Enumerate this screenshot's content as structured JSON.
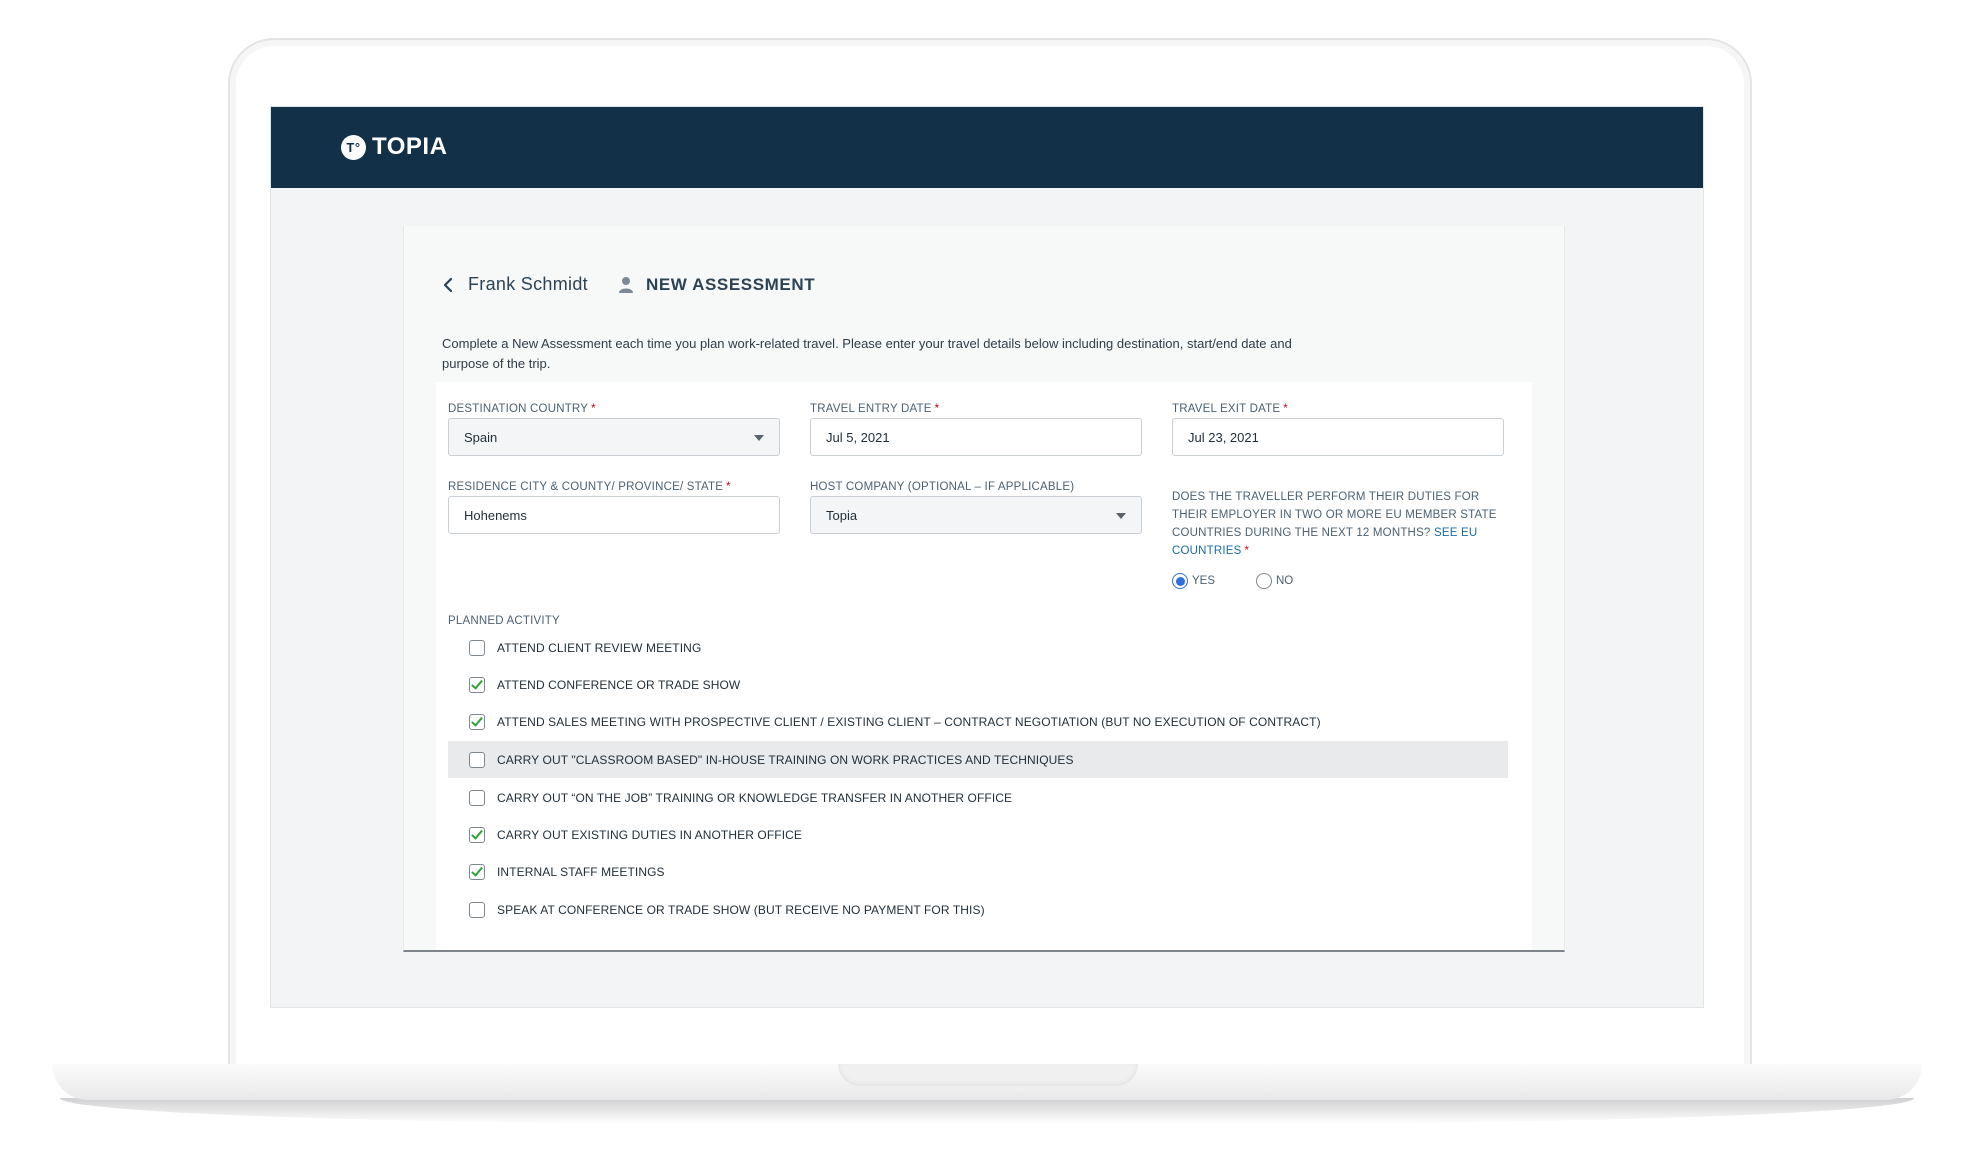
{
  "brand": {
    "name": "TOPIA",
    "mark": "T°"
  },
  "header": {
    "back_label": "Frank Schmidt",
    "title": "NEW ASSESSMENT"
  },
  "intro": "Complete a New Assessment each time you plan work-related travel. Please enter your travel details below including destination, start/end date and purpose of the trip.",
  "fields": {
    "destination_country": {
      "label": "DESTINATION COUNTRY",
      "value": "Spain"
    },
    "travel_entry_date": {
      "label": "TRAVEL ENTRY DATE",
      "value": "Jul 5, 2021"
    },
    "travel_exit_date": {
      "label": "TRAVEL EXIT DATE",
      "value": "Jul 23, 2021"
    },
    "residence": {
      "label": "RESIDENCE CITY & COUNTY/ PROVINCE/ STATE",
      "value": "Hohenems"
    },
    "host_company": {
      "label": "HOST COMPANY (OPTIONAL – IF APPLICABLE)",
      "value": "Topia"
    }
  },
  "eu_question": {
    "text": "DOES THE TRAVELLER PERFORM THEIR DUTIES FOR THEIR EMPLOYER IN TWO OR MORE EU MEMBER STATE COUNTRIES DURING THE NEXT 12 MONTHS?",
    "link": "SEE EU COUNTRIES",
    "yes_label": "YES",
    "no_label": "NO",
    "selected": "YES"
  },
  "planned_activity": {
    "label": "PLANNED ACTIVITY",
    "items": [
      {
        "label": "ATTEND CLIENT REVIEW MEETING",
        "checked": false
      },
      {
        "label": "ATTEND CONFERENCE OR TRADE SHOW",
        "checked": true
      },
      {
        "label": "ATTEND SALES MEETING WITH PROSPECTIVE CLIENT / EXISTING CLIENT – CONTRACT NEGOTIATION (BUT NO EXECUTION OF CONTRACT)",
        "checked": true
      },
      {
        "label": "CARRY OUT \"CLASSROOM BASED\" IN-HOUSE TRAINING ON WORK PRACTICES AND TECHNIQUES",
        "checked": false
      },
      {
        "label": "CARRY OUT “ON THE JOB” TRAINING OR KNOWLEDGE TRANSFER IN ANOTHER OFFICE",
        "checked": false
      },
      {
        "label": "CARRY OUT EXISTING DUTIES IN ANOTHER OFFICE",
        "checked": true
      },
      {
        "label": "INTERNAL STAFF MEETINGS",
        "checked": true
      },
      {
        "label": "SPEAK AT CONFERENCE OR TRADE SHOW (BUT RECEIVE NO PAYMENT FOR THIS)",
        "checked": false
      }
    ]
  },
  "colors": {
    "topbar": "#123149",
    "required": "#d0021b",
    "radio_selected": "#2f6fd8",
    "checkmark": "#2fa33c"
  }
}
